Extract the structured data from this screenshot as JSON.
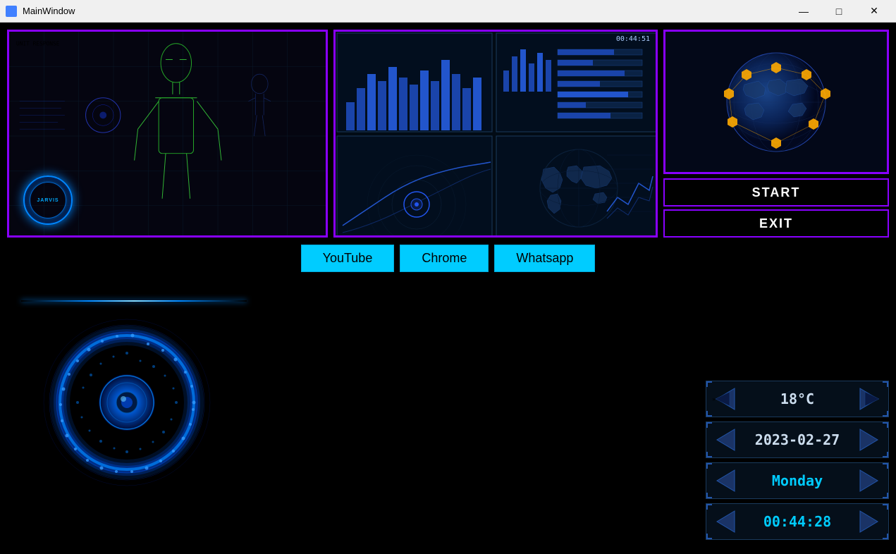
{
  "window": {
    "title": "MainWindow"
  },
  "titlebar": {
    "minimize": "—",
    "maximize": "□",
    "close": "✕"
  },
  "dashboard": {
    "time": "00:44:51"
  },
  "jarvis": {
    "circle_text": "JARVIS"
  },
  "actions": {
    "start_label": "START",
    "exit_label": "EXIT"
  },
  "app_buttons": {
    "youtube": "YouTube",
    "chrome": "Chrome",
    "whatsapp": "Whatsapp"
  },
  "info_panels": {
    "temperature": "18°C",
    "date": "2023-02-27",
    "day": "Monday",
    "time": "00:44:28"
  }
}
